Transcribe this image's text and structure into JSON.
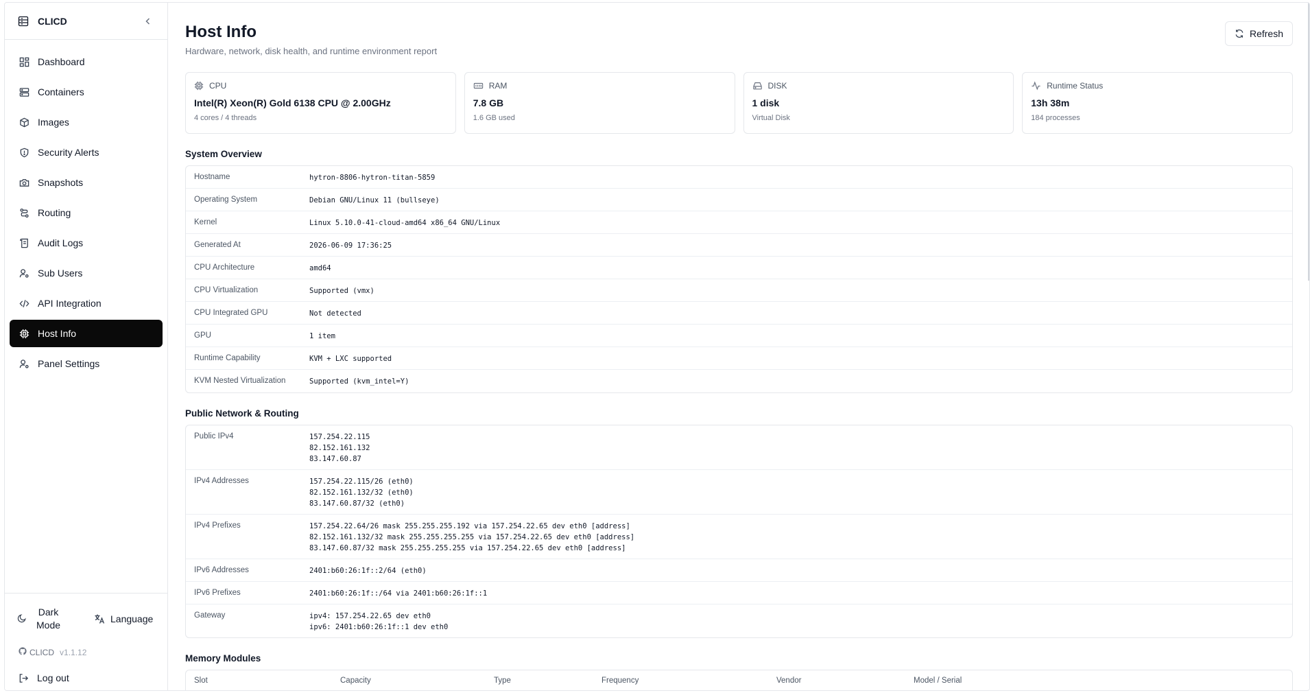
{
  "brand": {
    "title": "CLICD"
  },
  "sidebar": {
    "items": [
      {
        "label": "Dashboard",
        "icon": "dashboard-icon"
      },
      {
        "label": "Containers",
        "icon": "server-icon"
      },
      {
        "label": "Images",
        "icon": "package-icon"
      },
      {
        "label": "Security Alerts",
        "icon": "shield-icon"
      },
      {
        "label": "Snapshots",
        "icon": "camera-icon"
      },
      {
        "label": "Routing",
        "icon": "route-icon"
      },
      {
        "label": "Audit Logs",
        "icon": "scroll-icon"
      },
      {
        "label": "Sub Users",
        "icon": "user-cog-icon"
      },
      {
        "label": "API Integration",
        "icon": "code-icon"
      },
      {
        "label": "Host Info",
        "icon": "cpu-icon",
        "active": true
      },
      {
        "label": "Panel Settings",
        "icon": "user-cog-icon"
      }
    ],
    "dark_mode_line1": "Dark",
    "dark_mode_line2": "Mode",
    "language_label": "Language",
    "version_name": "CLICD",
    "version_number": "v1.1.12",
    "logout_label": "Log out"
  },
  "page": {
    "title": "Host Info",
    "subtitle": "Hardware, network, disk health, and runtime environment report",
    "refresh_label": "Refresh"
  },
  "cards": [
    {
      "label": "CPU",
      "icon": "cpu-icon",
      "value": "Intel(R) Xeon(R) Gold 6138 CPU @ 2.00GHz",
      "sub": "4 cores / 4 threads"
    },
    {
      "label": "RAM",
      "icon": "memory-icon",
      "value": "7.8 GB",
      "sub": "1.6 GB used"
    },
    {
      "label": "DISK",
      "icon": "hard-drive-icon",
      "value": "1 disk",
      "sub": "Virtual Disk"
    },
    {
      "label": "Runtime Status",
      "icon": "activity-icon",
      "value": "13h 38m",
      "sub": "184 processes"
    }
  ],
  "system_overview": {
    "title": "System Overview",
    "rows": [
      {
        "key": "Hostname",
        "value": "hytron-8806-hytron-titan-5859"
      },
      {
        "key": "Operating System",
        "value": "Debian GNU/Linux 11 (bullseye)"
      },
      {
        "key": "Kernel",
        "value": "Linux 5.10.0-41-cloud-amd64 x86_64 GNU/Linux"
      },
      {
        "key": "Generated At",
        "value": "2026-06-09 17:36:25"
      },
      {
        "key": "CPU Architecture",
        "value": "amd64"
      },
      {
        "key": "CPU Virtualization",
        "value": "Supported (vmx)"
      },
      {
        "key": "CPU Integrated GPU",
        "value": "Not detected"
      },
      {
        "key": "GPU",
        "value": "1 item"
      },
      {
        "key": "Runtime Capability",
        "value": "KVM + LXC supported"
      },
      {
        "key": "KVM Nested Virtualization",
        "value": "Supported (kvm_intel=Y)"
      }
    ]
  },
  "network": {
    "title": "Public Network & Routing",
    "rows": [
      {
        "key": "Public IPv4",
        "value": "157.254.22.115\n82.152.161.132\n83.147.60.87"
      },
      {
        "key": "IPv4 Addresses",
        "value": "157.254.22.115/26 (eth0)\n82.152.161.132/32 (eth0)\n83.147.60.87/32 (eth0)"
      },
      {
        "key": "IPv4 Prefixes",
        "value": "157.254.22.64/26 mask 255.255.255.192 via 157.254.22.65 dev eth0 [address]\n82.152.161.132/32 mask 255.255.255.255 via 157.254.22.65 dev eth0 [address]\n83.147.60.87/32 mask 255.255.255.255 via 157.254.22.65 dev eth0 [address]"
      },
      {
        "key": "IPv6 Addresses",
        "value": "2401:b60:26:1f::2/64 (eth0)"
      },
      {
        "key": "IPv6 Prefixes",
        "value": "2401:b60:26:1f::/64 via 2401:b60:26:1f::1"
      },
      {
        "key": "Gateway",
        "value": "ipv4: 157.254.22.65 dev eth0\nipv6: 2401:b60:26:1f::1 dev eth0"
      }
    ]
  },
  "memory": {
    "title": "Memory Modules",
    "columns": [
      "Slot",
      "Capacity",
      "Type",
      "Frequency",
      "Vendor",
      "Model / Serial"
    ]
  }
}
